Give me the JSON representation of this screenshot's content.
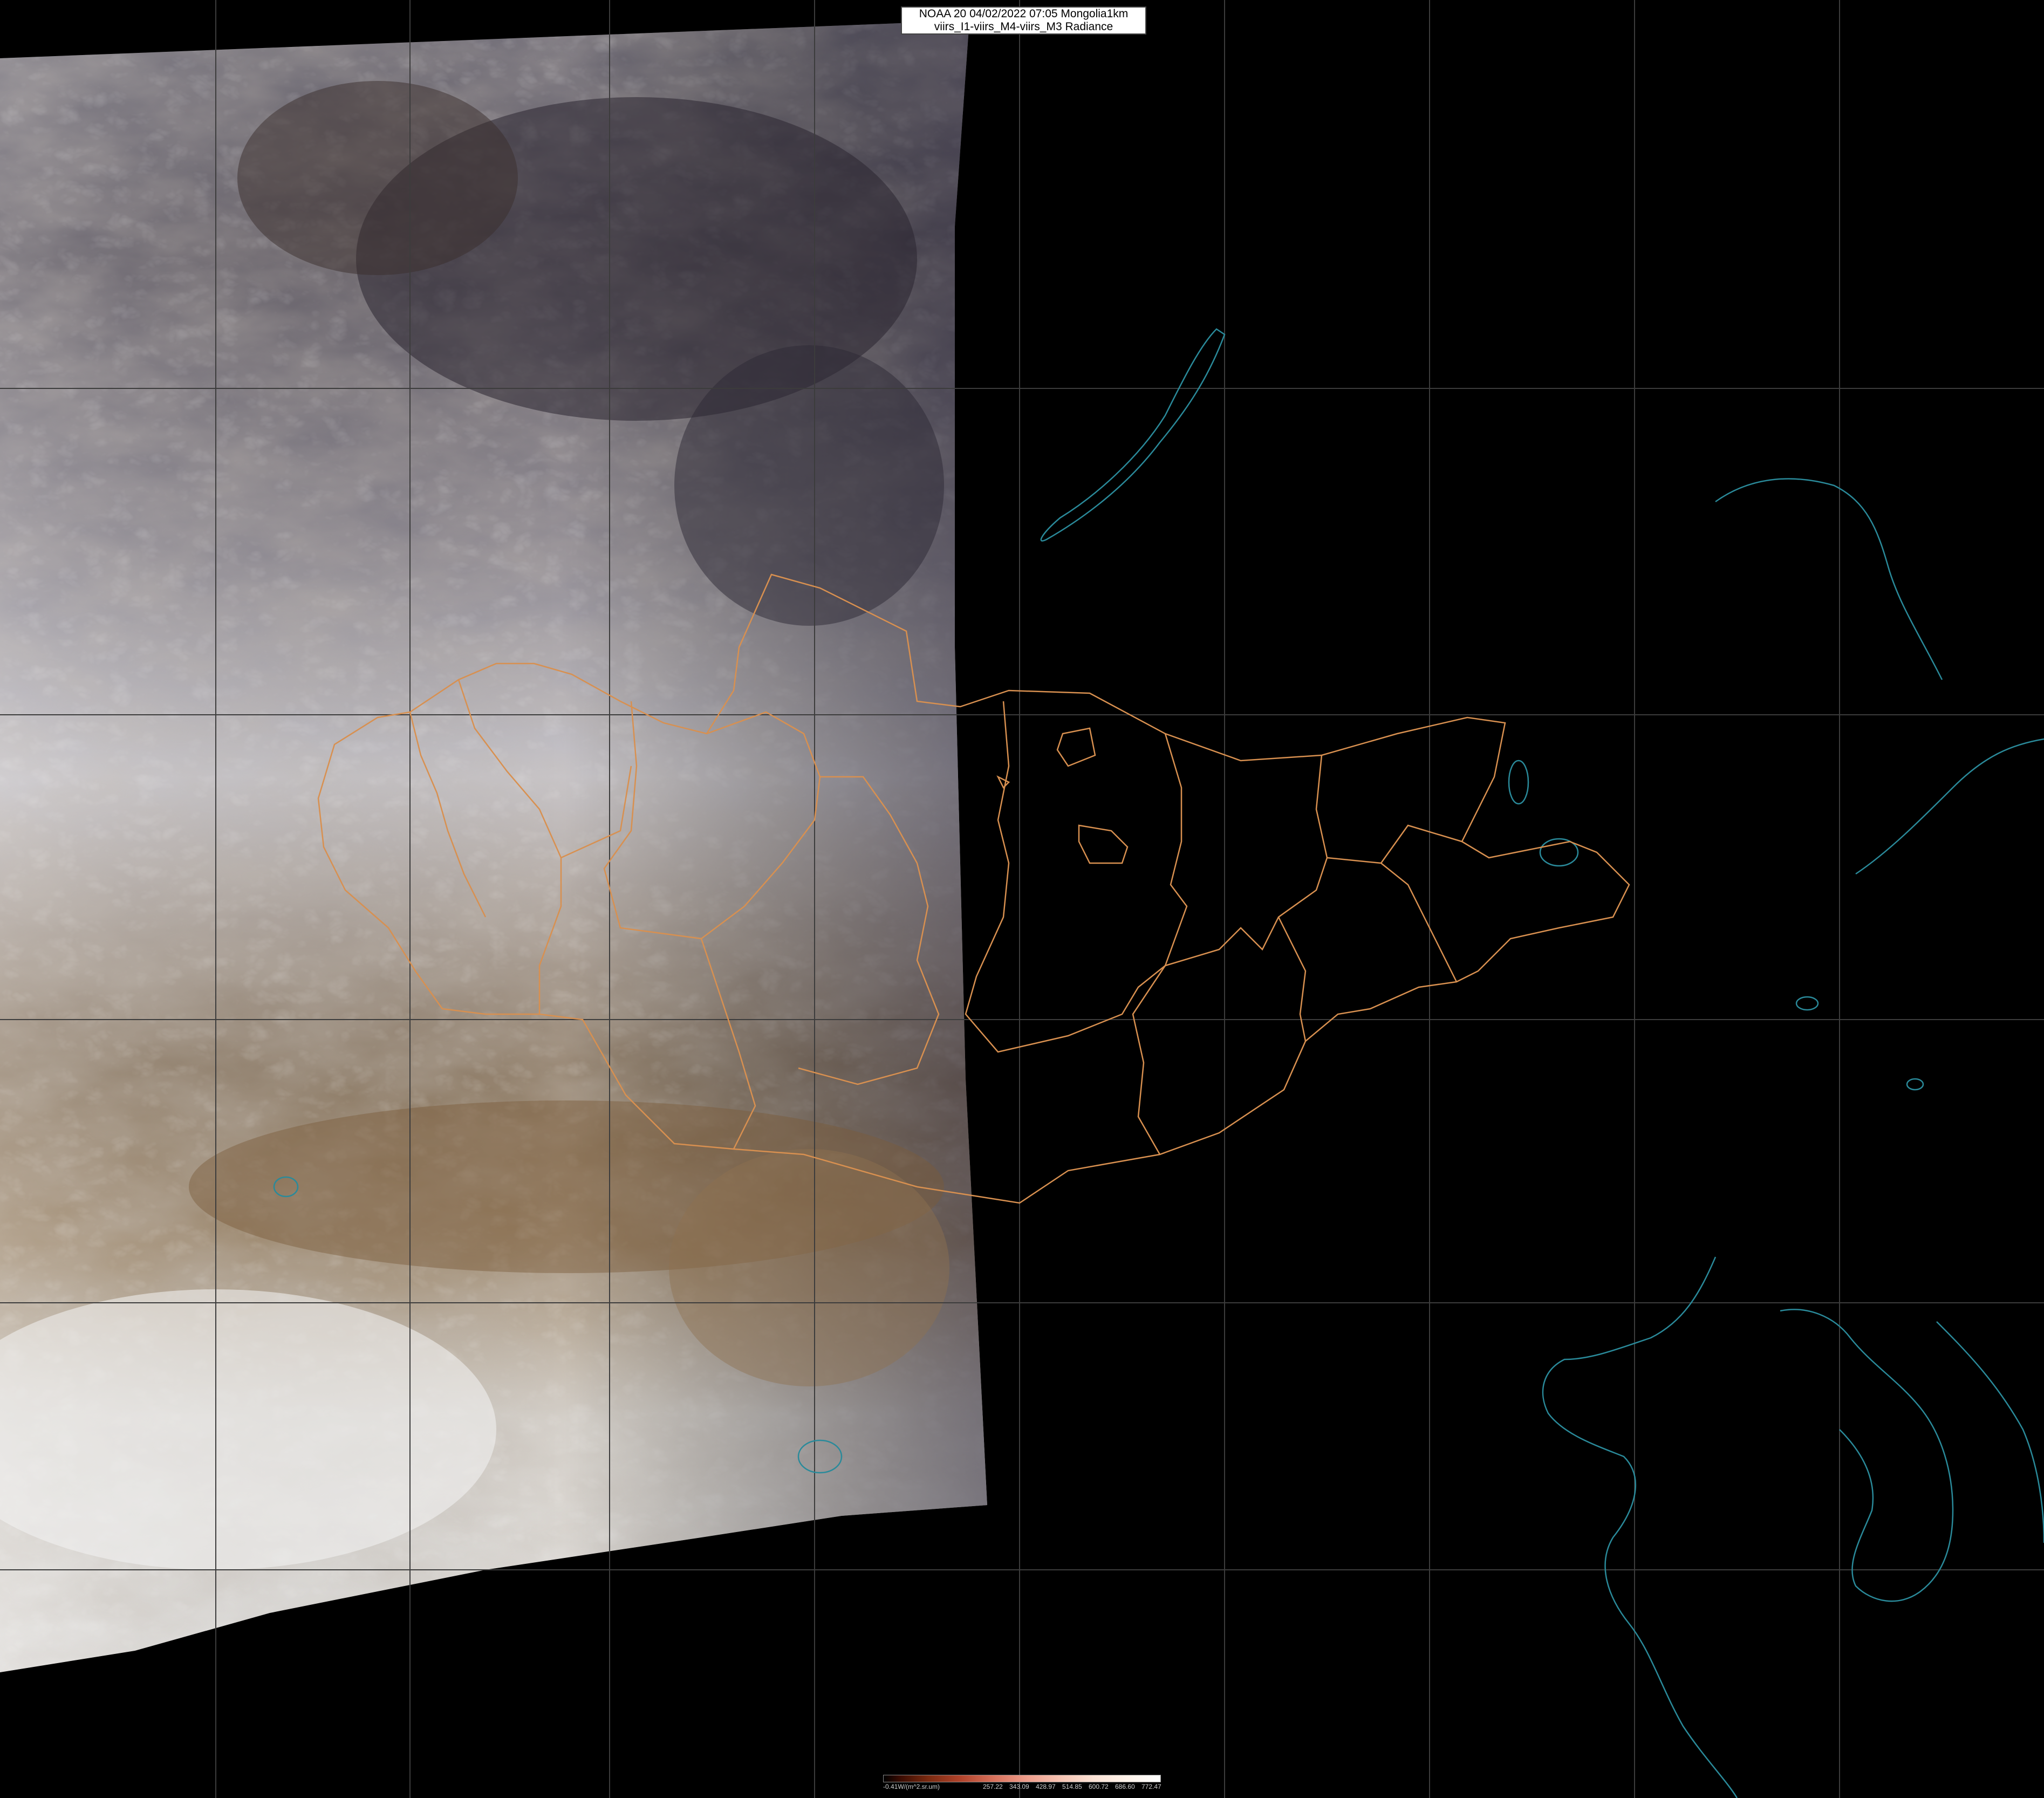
{
  "title": {
    "line1": "NOAA 20 04/02/2022 07:05 Mongolia1km",
    "line2": "viirs_I1-viirs_M4-viirs_M3 Radiance"
  },
  "colorbar": {
    "unit_label": "-0.41W/(m^2.sr.um)",
    "ticks": [
      "257.22",
      "343.09",
      "428.97",
      "514.85",
      "600.72",
      "686.60",
      "772.47"
    ]
  },
  "colors": {
    "background": "#000000",
    "grid": "#3c3c3c",
    "admin_boundary": "#d89050",
    "coastline": "#2a8a9a"
  }
}
